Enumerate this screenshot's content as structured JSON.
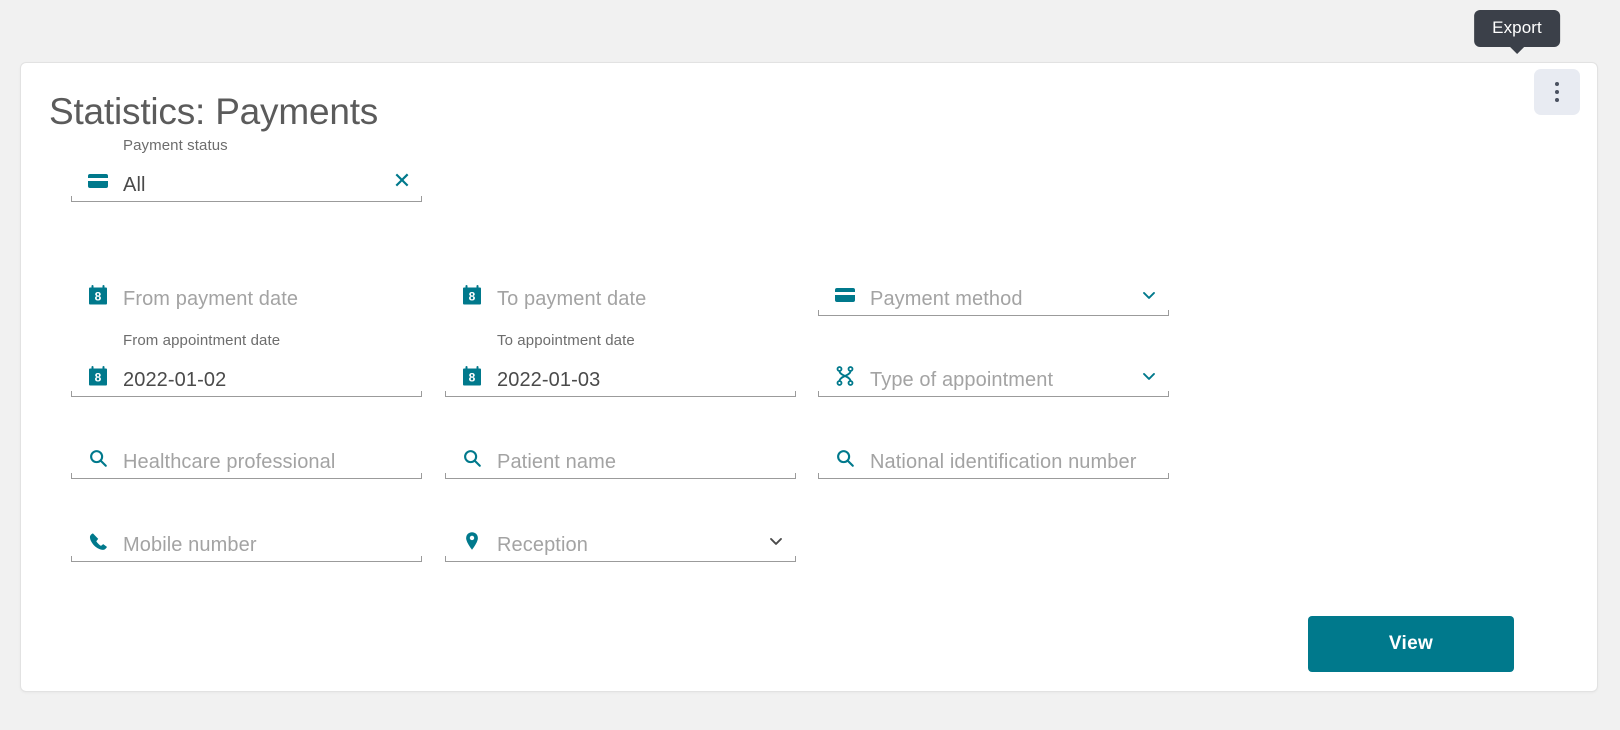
{
  "tooltip": {
    "label": "Export",
    "icon": "export-tooltip",
    "bg": "#3b4049"
  },
  "card": {
    "title": "Statistics: Payments",
    "menu_icon": "kebab-menu-icon"
  },
  "theme": {
    "accent": "#00798c",
    "page_bg": "#f1f1f1",
    "card_bg": "#ffffff",
    "text": "#4a4a4a",
    "placeholder": "#a3a3a3"
  },
  "form": {
    "payment_status": {
      "label": "Payment status",
      "value": "All",
      "icon": "credit-card-icon",
      "clear_icon": "close-icon"
    },
    "from_payment_date": {
      "placeholder": "From payment date",
      "icon": "calendar-icon"
    },
    "to_payment_date": {
      "placeholder": "To payment date",
      "icon": "calendar-icon"
    },
    "payment_method": {
      "placeholder": "Payment method",
      "icon": "credit-card-icon",
      "chevron": "chevron-down-icon"
    },
    "from_appointment_date": {
      "label": "From appointment date",
      "value": "2022-01-02",
      "icon": "calendar-icon"
    },
    "to_appointment_date": {
      "label": "To appointment date",
      "value": "2022-01-03",
      "icon": "calendar-icon"
    },
    "type_of_appointment": {
      "placeholder": "Type of appointment",
      "icon": "network-nodes-icon",
      "chevron": "chevron-down-icon"
    },
    "healthcare_professional": {
      "placeholder": "Healthcare professional",
      "icon": "search-icon"
    },
    "patient_name": {
      "placeholder": "Patient name",
      "icon": "search-icon"
    },
    "national_identification_number": {
      "placeholder": "National identification number",
      "icon": "search-icon"
    },
    "mobile_number": {
      "placeholder": "Mobile number",
      "icon": "phone-icon"
    },
    "reception": {
      "placeholder": "Reception",
      "icon": "map-pin-icon",
      "chevron": "chevron-down-icon"
    }
  },
  "actions": {
    "view_label": "View"
  }
}
